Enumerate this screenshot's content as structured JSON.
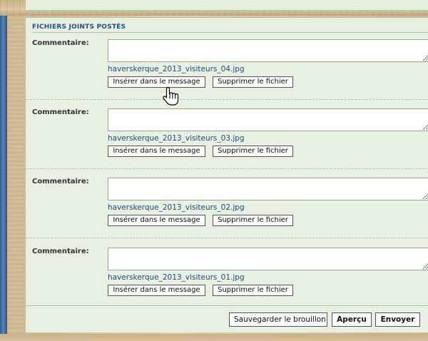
{
  "section": {
    "title": "FICHIERS JOINTS POSTÉS"
  },
  "attachments": [
    {
      "label": "Commentaire:",
      "comment_value": "",
      "filename": "haverskerque_2013_visiteurs_04.jpg",
      "insert_label": "Insérer dans le message",
      "delete_label": "Supprimer le fichier"
    },
    {
      "label": "Commentaire:",
      "comment_value": "",
      "filename": "haverskerque_2013_visiteurs_03.jpg",
      "insert_label": "Insérer dans le message",
      "delete_label": "Supprimer le fichier"
    },
    {
      "label": "Commentaire:",
      "comment_value": "",
      "filename": "haverskerque_2013_visiteurs_02.jpg",
      "insert_label": "Insérer dans le message",
      "delete_label": "Supprimer le fichier"
    },
    {
      "label": "Commentaire:",
      "comment_value": "",
      "filename": "haverskerque_2013_visiteurs_01.jpg",
      "insert_label": "Insérer dans le message",
      "delete_label": "Supprimer le fichier"
    }
  ],
  "footer": {
    "save_draft_label": "Sauvegarder le brouillon",
    "preview_label": "Aperçu",
    "submit_label": "Envoyer"
  },
  "colors": {
    "panel_bg": "#e8f0e1",
    "title_blue": "#1f4f86",
    "link_blue": "#1a4c86"
  },
  "cursor": {
    "icon": "hand-pointer-icon"
  }
}
